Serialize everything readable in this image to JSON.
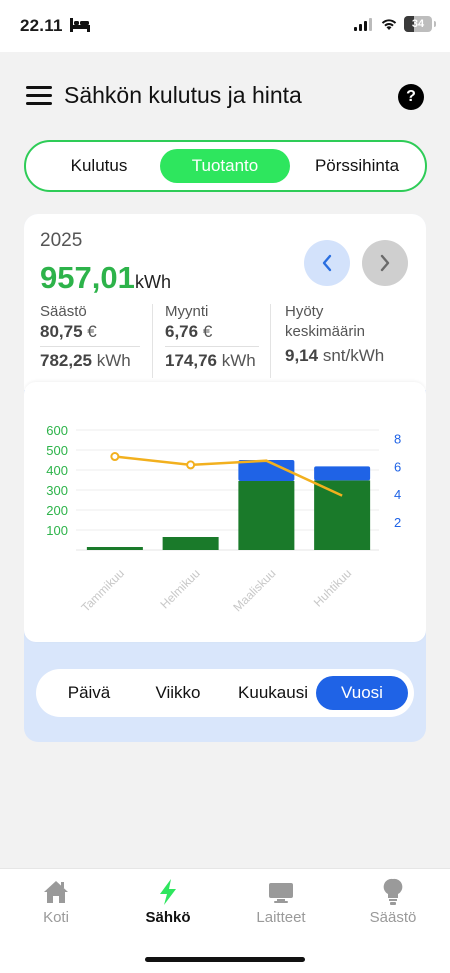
{
  "status_bar": {
    "time": "22.11",
    "battery": "34"
  },
  "header": {
    "title": "Sähkön kulutus ja hinta",
    "help": "?"
  },
  "tabs": [
    {
      "label": "Kulutus",
      "active": false
    },
    {
      "label": "Tuotanto",
      "active": true
    },
    {
      "label": "Pörssihinta",
      "active": false
    }
  ],
  "summary": {
    "year": "2025",
    "total_value": "957,01",
    "total_unit": "kWh",
    "savings": {
      "label": "Säästö",
      "euro_value": "80,75",
      "euro_unit": "€",
      "kwh_value": "782,25",
      "kwh_unit": "kWh"
    },
    "sales": {
      "label": "Myynti",
      "euro_value": "6,76",
      "euro_unit": "€",
      "kwh_value": "174,76",
      "kwh_unit": "kWh"
    },
    "benefit": {
      "label_line1": "Hyöty",
      "label_line2": "keskimäärin",
      "value": "9,14",
      "unit": "snt/kWh"
    }
  },
  "chart_data": {
    "type": "bar",
    "categories": [
      "Tammikuu",
      "Helmikuu",
      "Maaliskuu",
      "Huhtikuu"
    ],
    "series": [
      {
        "values": [
          15,
          65,
          345,
          348
        ],
        "color": "#1a7a2a"
      },
      {
        "values": [
          0,
          0,
          105,
          70
        ],
        "color": "#1f63e6"
      }
    ],
    "line_series": {
      "values": [
        6.7,
        6.1,
        6.4,
        3.9
      ],
      "color": "#f2b01e",
      "axis": "right"
    },
    "left_ticks": [
      "100",
      "200",
      "300",
      "400",
      "500",
      "600"
    ],
    "right_ticks": [
      "2",
      "4",
      "6",
      "8"
    ],
    "ylim": [
      0,
      600
    ],
    "y2lim": [
      0,
      8.6
    ],
    "stacked": true,
    "left_tick_color": "#2db34a",
    "right_tick_color": "#1f63e6"
  },
  "period_tabs": [
    {
      "label": "Päivä",
      "active": false
    },
    {
      "label": "Viikko",
      "active": false
    },
    {
      "label": "Kuukausi",
      "active": false
    },
    {
      "label": "Vuosi",
      "active": true
    }
  ],
  "bottom_nav": [
    {
      "label": "Koti",
      "icon": "home-icon",
      "active": false
    },
    {
      "label": "Sähkö",
      "icon": "bolt-icon",
      "active": true
    },
    {
      "label": "Laitteet",
      "icon": "monitor-icon",
      "active": false
    },
    {
      "label": "Säästö",
      "icon": "lightbulb-icon",
      "active": false
    }
  ]
}
